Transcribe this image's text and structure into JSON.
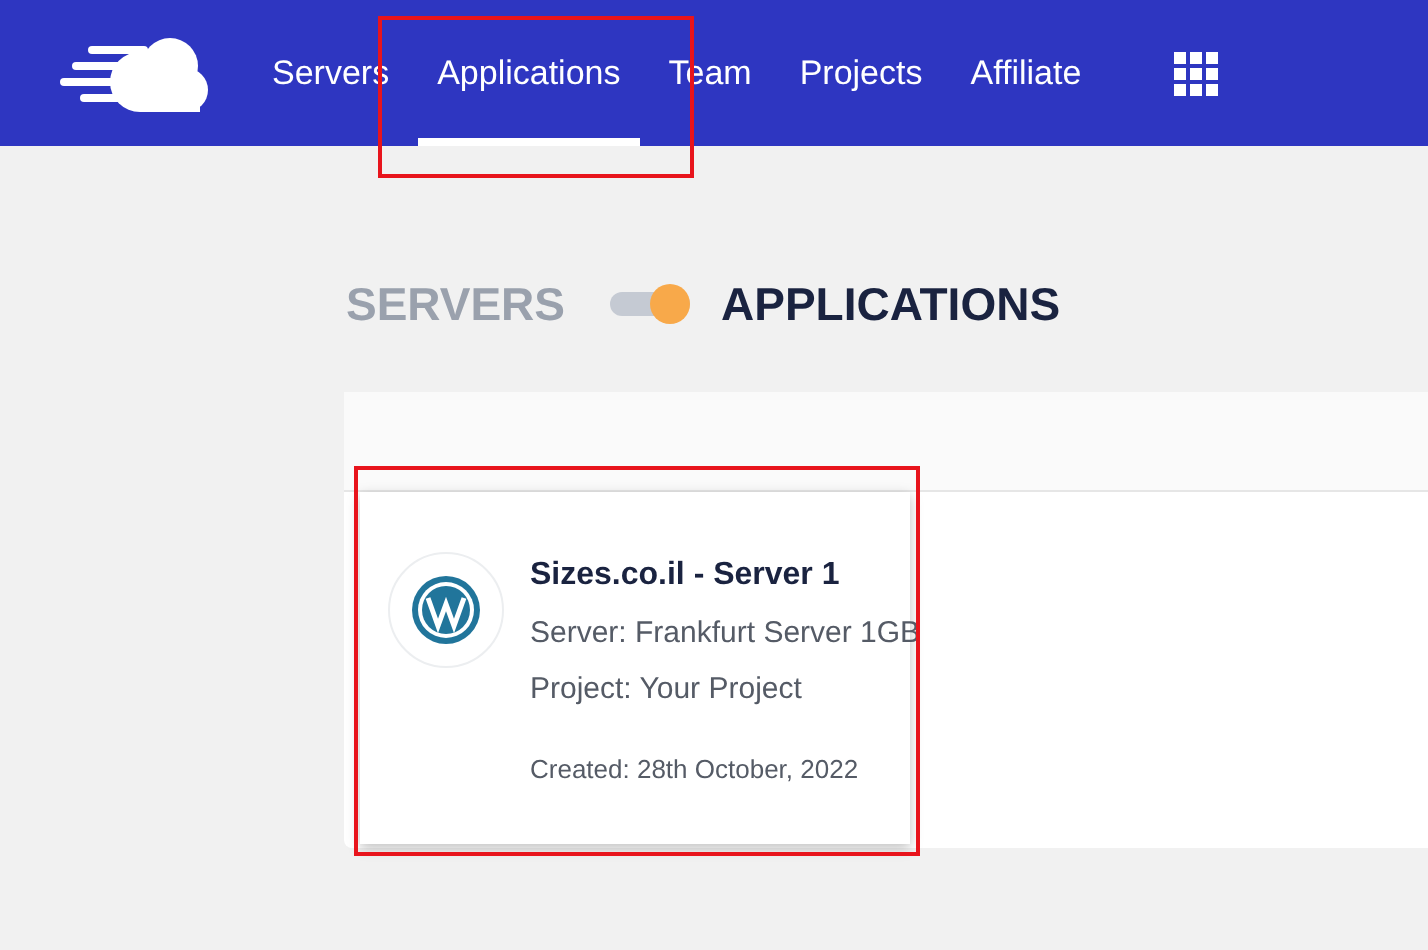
{
  "nav": {
    "items": [
      {
        "label": "Servers",
        "selected": false
      },
      {
        "label": "Applications",
        "selected": true
      },
      {
        "label": "Team",
        "selected": false
      },
      {
        "label": "Projects",
        "selected": false
      },
      {
        "label": "Affiliate",
        "selected": false
      }
    ]
  },
  "view_toggle": {
    "left_label": "SERVERS",
    "right_label": "APPLICATIONS",
    "on": true
  },
  "applications": [
    {
      "name": "Sizes.co.il - Server 1",
      "server": "Server: Frankfurt Server 1GB",
      "project": "Project: Your Project",
      "created": "Created: 28th October, 2022"
    }
  ]
}
